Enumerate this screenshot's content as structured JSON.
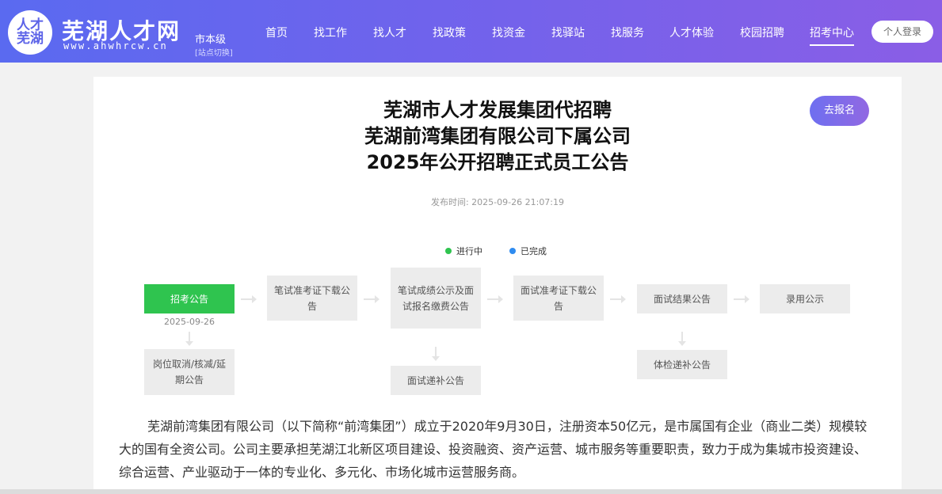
{
  "header": {
    "logo_mark": "人才芜湖",
    "logo_name": "芜湖人才网",
    "logo_url": "www.ahwhrcw.cn",
    "city_level": "市本级",
    "city_switch": "[站点切换]",
    "nav": [
      "首页",
      "找工作",
      "找人才",
      "找政策",
      "找资金",
      "找驿站",
      "找服务",
      "人才体验",
      "校园招聘",
      "招考中心"
    ],
    "active_nav": "招考中心",
    "login": "个人登录"
  },
  "article": {
    "title_line1": "芜湖市人才发展集团代招聘",
    "title_line2": "芜湖前湾集团有限公司下属公司",
    "title_line3": "2025年公开招聘正式员工公告",
    "publish_time": "发布时间: 2025-09-26 21:07:19",
    "signup_button": "去报名"
  },
  "legend": {
    "in_progress": "进行中",
    "completed": "已完成",
    "in_progress_color": "#2fc44f",
    "completed_color": "#2f8cf0"
  },
  "steps": {
    "s1": "招考公告",
    "s1_date": "2025-09-26",
    "s2": "笔试准考证下载公告",
    "s3": "笔试成绩公示及面试报名缴费公告",
    "s4": "面试准考证下载公告",
    "s5": "面试结果公告",
    "s6": "录用公示",
    "sub1": "岗位取消/核减/延期公告",
    "sub3": "面试递补公告",
    "sub5": "体检递补公告"
  },
  "body_text": "芜湖前湾集团有限公司（以下简称“前湾集团”）成立于2020年9月30日，注册资本50亿元，是市属国有企业（商业二类）规模较大的国有全资公司。公司主要承担芜湖江北新区项目建设、投资融资、资产运营、城市服务等重要职责，致力于成为集城市投资建设、综合运营、产业驱动于一体的专业化、多元化、市场化城市运营服务商。"
}
